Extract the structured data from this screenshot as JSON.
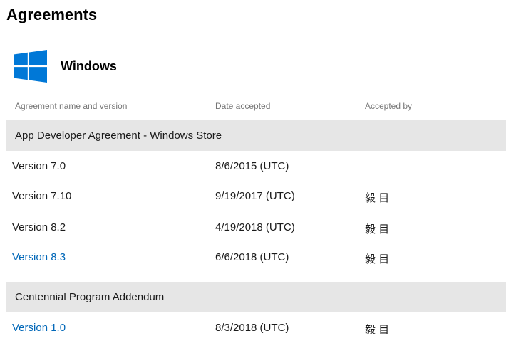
{
  "page": {
    "title": "Agreements"
  },
  "product": {
    "name": "Windows",
    "logo_icon": "windows-logo-icon",
    "logo_color": "#0078d7"
  },
  "columns": {
    "name": "Agreement name and version",
    "date": "Date accepted",
    "by": "Accepted by"
  },
  "sections": [
    {
      "title": "App Developer Agreement - Windows Store",
      "rows": [
        {
          "version": "Version 7.0",
          "date": "8/6/2015 (UTC)",
          "accepted_by": "",
          "is_link": false
        },
        {
          "version": "Version 7.10",
          "date": "9/19/2017 (UTC)",
          "accepted_by": "毅 目",
          "is_link": false
        },
        {
          "version": "Version 8.2",
          "date": "4/19/2018 (UTC)",
          "accepted_by": "毅 目",
          "is_link": false
        },
        {
          "version": "Version 8.3",
          "date": "6/6/2018 (UTC)",
          "accepted_by": "毅 目",
          "is_link": true
        }
      ]
    },
    {
      "title": "Centennial Program Addendum",
      "rows": [
        {
          "version": "Version 1.0",
          "date": "8/3/2018 (UTC)",
          "accepted_by": "毅 目",
          "is_link": true
        }
      ]
    }
  ],
  "colors": {
    "link": "#0067b8",
    "section_background": "#e6e6e6",
    "column_header_text": "#767676"
  }
}
